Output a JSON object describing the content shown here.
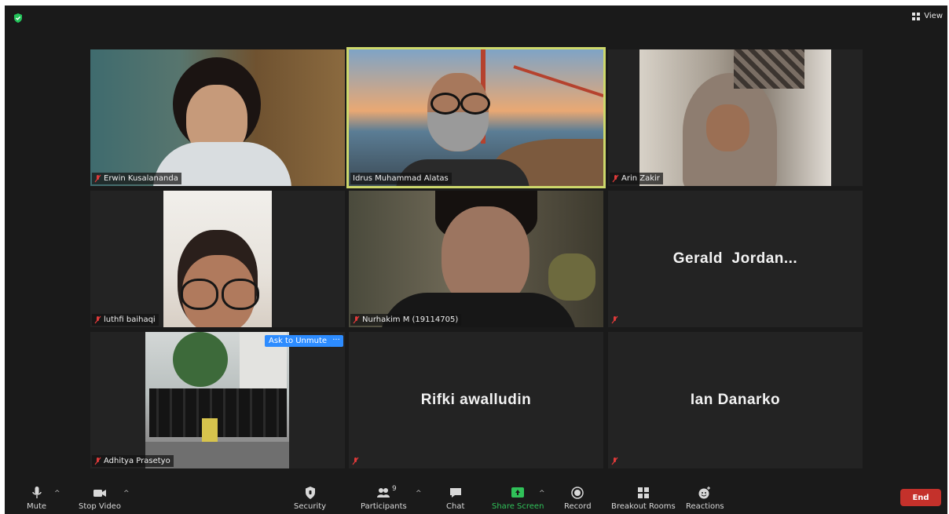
{
  "view_label": "View",
  "tiles": [
    {
      "name": "Erwin Kusalananda"
    },
    {
      "name": "Idrus Muhammad Alatas"
    },
    {
      "name": "Arin Zakir"
    },
    {
      "name": "luthfi baihaqi"
    },
    {
      "name": "Nurhakim M (19114705)"
    },
    {
      "name": "Gerald  Jordan..."
    },
    {
      "name": "Adhitya Prasetyo"
    },
    {
      "name": "Rifki awalludin"
    },
    {
      "name": "Ian Danarko"
    }
  ],
  "ask_to_unmute": "Ask to Unmute",
  "more_label": "···",
  "toolbar": {
    "mute": "Mute",
    "stop_video": "Stop Video",
    "security": "Security",
    "participants": "Participants",
    "participants_count": "9",
    "chat": "Chat",
    "share_screen": "Share Screen",
    "record": "Record",
    "breakout_rooms": "Breakout Rooms",
    "reactions": "Reactions",
    "end": "End"
  },
  "colors": {
    "accent": "#2d8cff",
    "active_border": "#cdd86b",
    "share_green": "#30c159",
    "end_red": "#c4312b"
  }
}
